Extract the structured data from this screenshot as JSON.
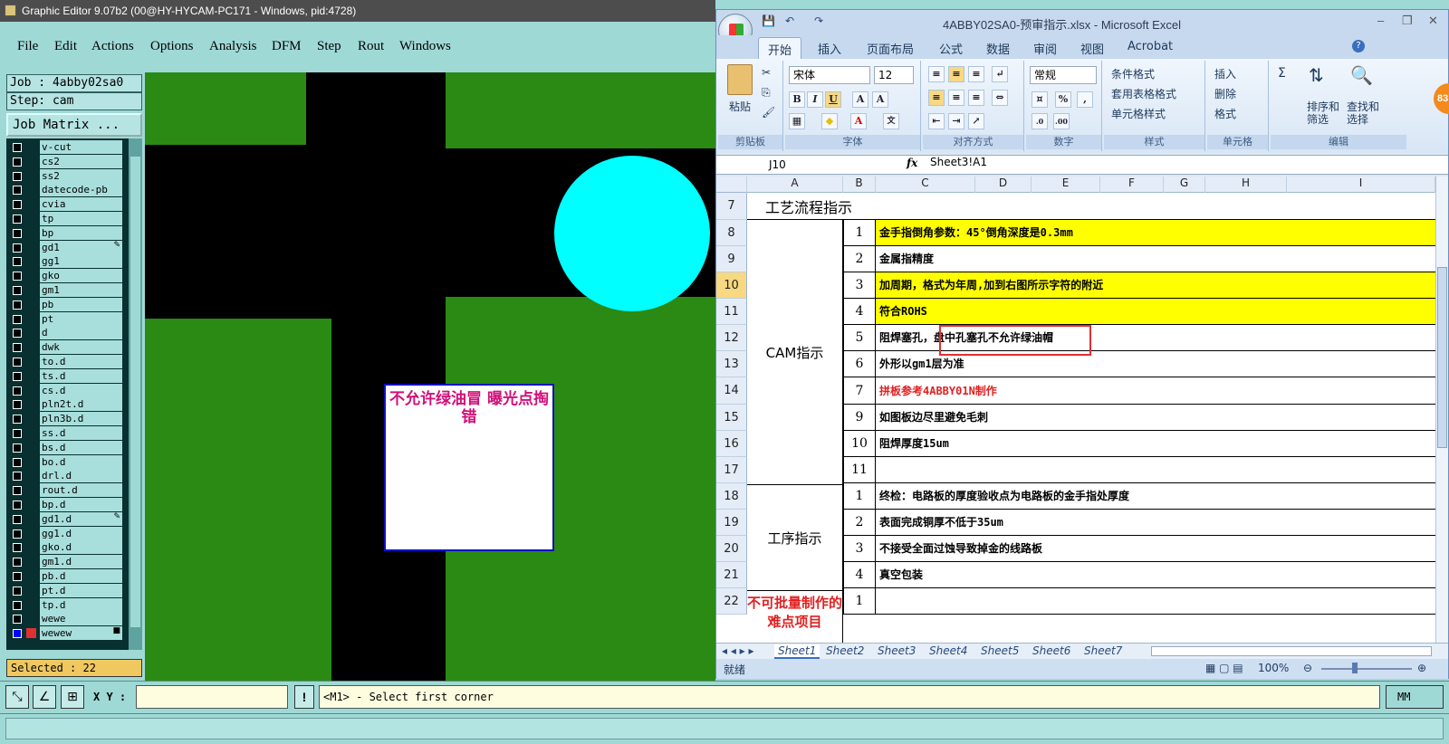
{
  "ge": {
    "title": "Graphic Editor 9.07b2 (00@HY-HYCAM-PC171 - Windows, pid:4728)",
    "menu": [
      "File",
      "Edit",
      "Actions",
      "Options",
      "Analysis",
      "DFM",
      "Step",
      "Rout",
      "Windows"
    ],
    "job": "Job : 4abby02sa0",
    "step": "Step: cam",
    "job_matrix": "Job Matrix ...",
    "layers": [
      "v-cut",
      "cs2",
      "ss2",
      "datecode-pb",
      "cvia",
      "tp",
      "bp",
      "gd1",
      "gg1",
      "gko",
      "gm1",
      "pb",
      "pt",
      "d",
      "dwk",
      "to.d",
      "ts.d",
      "cs.d",
      "pln2t.d",
      "pln3b.d",
      "ss.d",
      "bs.d",
      "bo.d",
      "drl.d",
      "rout.d",
      "bp.d",
      "gd1.d",
      "gg1.d",
      "gko.d",
      "gm1.d",
      "pb.d",
      "pt.d",
      "tp.d",
      "wewe",
      "wewew"
    ],
    "selected": "Selected : 22",
    "canvas_note": "不允许绿油冒   曝光点掏错",
    "xy_label": "X Y :",
    "xy_value": "",
    "message": "<M1> - Select first corner",
    "unit": "MM"
  },
  "excel": {
    "title": "4ABBY02SA0-预审指示.xlsx - Microsoft Excel",
    "tabs": [
      "开始",
      "插入",
      "页面布局",
      "公式",
      "数据",
      "审阅",
      "视图",
      "Acrobat"
    ],
    "ribbon": {
      "paste": "粘贴",
      "clipboard": "剪贴板",
      "font_name": "宋体",
      "font_size": "12",
      "font_group": "字体",
      "align_group": "对齐方式",
      "number_format": "常规",
      "number_group": "数字",
      "cond_format": "条件格式",
      "table_format": "套用表格格式",
      "cell_style": "单元格样式",
      "style_group": "样式",
      "insert": "插入",
      "delete": "删除",
      "format": "格式",
      "cells_group": "单元格",
      "sort": "排序和\n筛选",
      "find": "查找和\n选择",
      "edit_group": "编辑"
    },
    "name_box": "J10",
    "formula": "Sheet3!A1",
    "columns": [
      "A",
      "B",
      "C",
      "D",
      "E",
      "F",
      "G",
      "H",
      "I"
    ],
    "rows": [
      {
        "n": "7",
        "b": "",
        "c": "",
        "y": false
      },
      {
        "n": "8",
        "b": "1",
        "c": "金手指倒角参数：45°倒角深度是0.3mm",
        "y": true
      },
      {
        "n": "9",
        "b": "2",
        "c": "金属指精度",
        "y": false
      },
      {
        "n": "10",
        "b": "3",
        "c": "加周期，格式为年周,加到右图所示字符的附近",
        "y": true
      },
      {
        "n": "11",
        "b": "4",
        "c": "符合ROHS",
        "y": true
      },
      {
        "n": "12",
        "b": "5",
        "c": "阻焊塞孔，盘中孔塞孔不允许绿油帽",
        "y": false
      },
      {
        "n": "13",
        "b": "6",
        "c": "外形以gm1层为准",
        "y": false
      },
      {
        "n": "14",
        "b": "7",
        "c": "拼板参考4ABBY01N制作",
        "y": false,
        "red": true
      },
      {
        "n": "15",
        "b": "9",
        "c": "如图板边尽里避免毛刺",
        "y": false
      },
      {
        "n": "16",
        "b": "10",
        "c": "阻焊厚度15um",
        "y": false
      },
      {
        "n": "17",
        "b": "11",
        "c": "",
        "y": false
      },
      {
        "n": "18",
        "b": "1",
        "c": "终检：电路板的厚度验收点为电路板的金手指处厚度",
        "y": false
      },
      {
        "n": "19",
        "b": "2",
        "c": "表面完成铜厚不低于35um",
        "y": false
      },
      {
        "n": "20",
        "b": "3",
        "c": "不接受全面过蚀导致掉金的线路板",
        "y": false
      },
      {
        "n": "21",
        "b": "4",
        "c": "真空包装",
        "y": false
      },
      {
        "n": "22",
        "b": "1",
        "c": "",
        "y": false
      }
    ],
    "merged": {
      "r7": "工艺流程指示",
      "cam": "CAM指示",
      "process": "工序指示",
      "difficult": "不可批量制作的难点项目"
    },
    "sheets": [
      "Sheet1",
      "Sheet2",
      "Sheet3",
      "Sheet4",
      "Sheet5",
      "Sheet6",
      "Sheet7"
    ],
    "status": "就绪",
    "zoom": "100%",
    "badge": "83"
  },
  "colors": {
    "green": "#2a8a14",
    "cyan": "#00ffff",
    "yellow": "#ffff00",
    "accent": "#e03030"
  }
}
